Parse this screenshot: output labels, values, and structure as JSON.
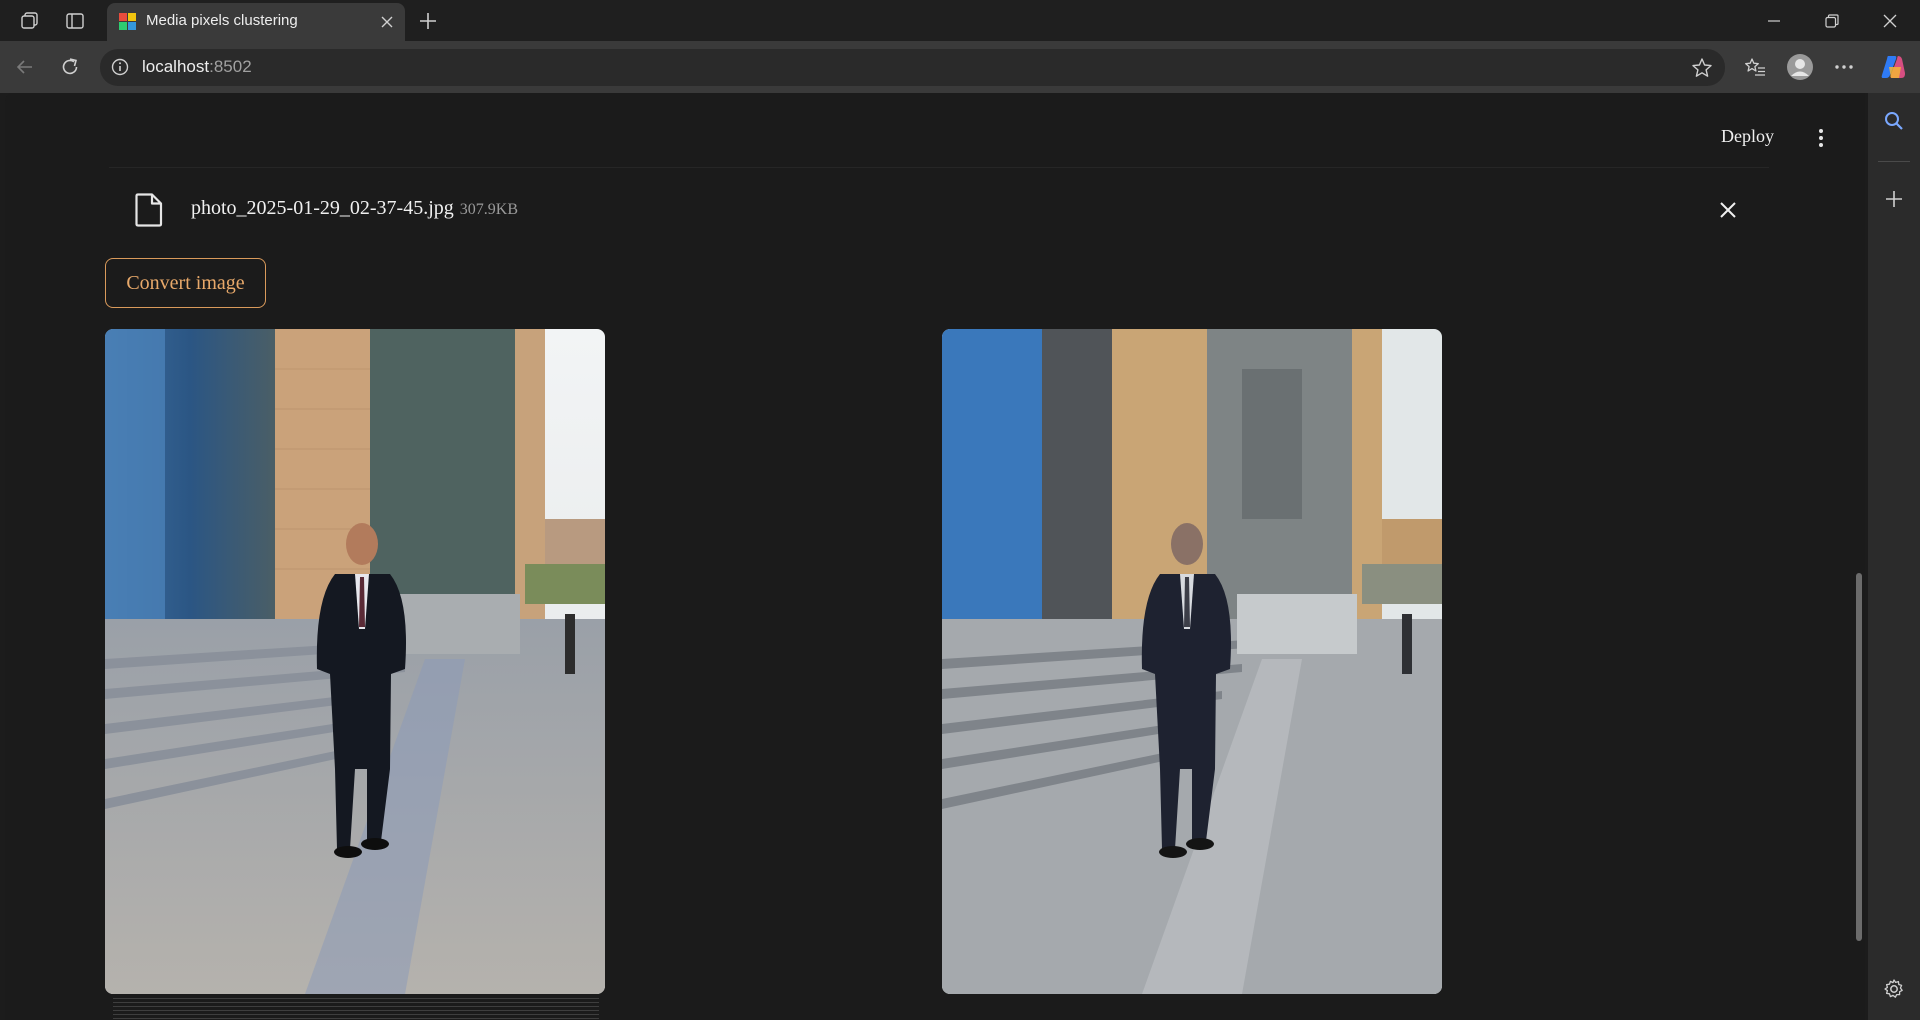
{
  "browser": {
    "tab_title": "Media pixels clustering",
    "url_host": "localhost",
    "url_port": ":8502"
  },
  "app": {
    "deploy_label": "Deploy",
    "file": {
      "name": "photo_2025-01-29_02-37-45.jpg",
      "size": "307.9KB"
    },
    "convert_label": "Convert image"
  },
  "colors": {
    "accent": "#e8a96a",
    "background": "#1b1b1b"
  }
}
